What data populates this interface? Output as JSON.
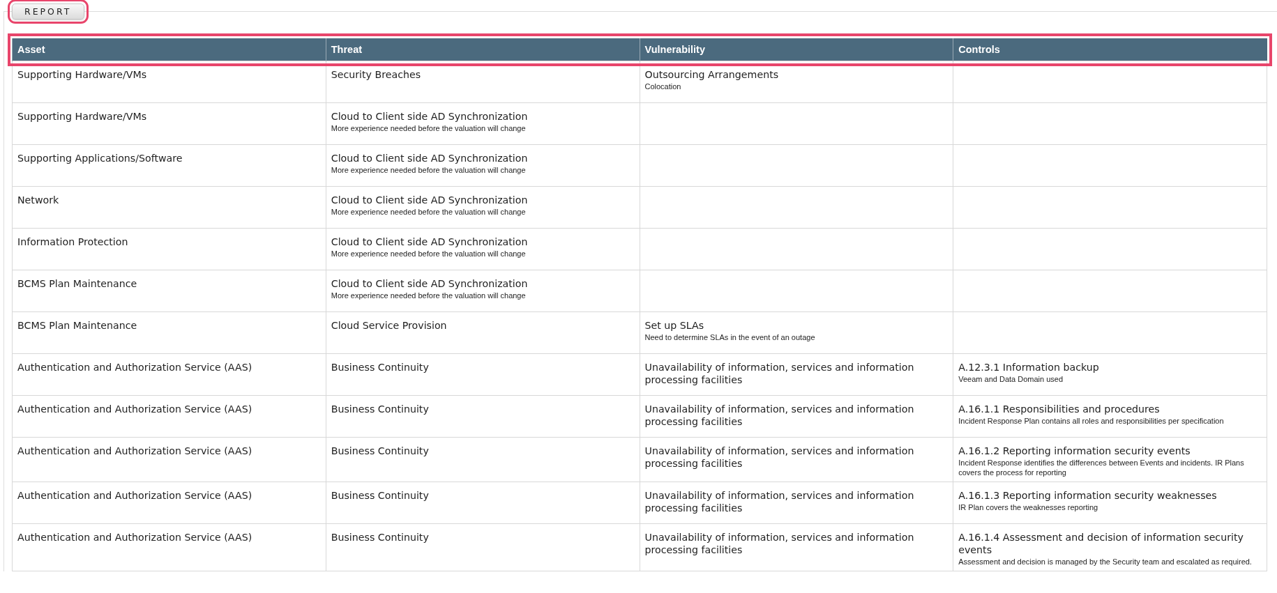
{
  "report_button": {
    "label": "REPORT"
  },
  "table": {
    "columns": [
      "Asset",
      "Threat",
      "Vulnerability",
      "Controls"
    ],
    "rows": [
      {
        "asset": "Supporting Hardware/VMs",
        "threat": {
          "title": "Security Breaches"
        },
        "vulnerability": {
          "title": "Outsourcing Arrangements",
          "note": "Colocation"
        }
      },
      {
        "asset": "Supporting Hardware/VMs",
        "threat": {
          "title": "Cloud to Client side AD Synchronization",
          "note": "More experience needed before the valuation will change"
        }
      },
      {
        "asset": "Supporting Applications/Software",
        "threat": {
          "title": "Cloud to Client side AD Synchronization",
          "note": "More experience needed before the valuation will change"
        }
      },
      {
        "asset": "Network",
        "threat": {
          "title": "Cloud to Client side AD Synchronization",
          "note": "More experience needed before the valuation will change"
        }
      },
      {
        "asset": "Information Protection",
        "threat": {
          "title": "Cloud to Client side AD Synchronization",
          "note": "More experience needed before the valuation will change"
        }
      },
      {
        "asset": "BCMS Plan Maintenance",
        "threat": {
          "title": "Cloud to Client side AD Synchronization",
          "note": "More experience needed before the valuation will change"
        }
      },
      {
        "asset": "BCMS Plan Maintenance",
        "threat": {
          "title": "Cloud Service Provision"
        },
        "vulnerability": {
          "title": "Set up SLAs",
          "note": "Need to determine SLAs in the event of an outage"
        }
      },
      {
        "asset": "Authentication and Authorization Service (AAS)",
        "threat": {
          "title": "Business Continuity"
        },
        "vulnerability": {
          "title": "Unavailability of information, services and information processing facilities"
        },
        "controls": {
          "title": "A.12.3.1 Information backup",
          "note": "Veeam and Data Domain used"
        }
      },
      {
        "asset": "Authentication and Authorization Service (AAS)",
        "threat": {
          "title": "Business Continuity"
        },
        "vulnerability": {
          "title": "Unavailability of information, services and information processing facilities"
        },
        "controls": {
          "title": "A.16.1.1 Responsibilities and procedures",
          "note": "Incident Response Plan contains all roles and responsibilities per specification"
        }
      },
      {
        "asset": "Authentication and Authorization Service (AAS)",
        "threat": {
          "title": "Business Continuity"
        },
        "vulnerability": {
          "title": "Unavailability of information, services and information processing facilities"
        },
        "controls": {
          "title": "A.16.1.2 Reporting information security events",
          "note": "Incident Response identifies the differences between Events and incidents. IR Plans covers the process for reporting"
        }
      },
      {
        "asset": "Authentication and Authorization Service (AAS)",
        "threat": {
          "title": "Business Continuity"
        },
        "vulnerability": {
          "title": "Unavailability of information, services and information processing facilities"
        },
        "controls": {
          "title": "A.16.1.3 Reporting information security weaknesses",
          "note": "IR Plan covers the weaknesses reporting"
        }
      },
      {
        "asset": "Authentication and Authorization Service (AAS)",
        "threat": {
          "title": "Business Continuity"
        },
        "vulnerability": {
          "title": "Unavailability of information, services and information processing facilities"
        },
        "controls": {
          "title": "A.16.1.4 Assessment and decision of information security events",
          "note": "Assessment and decision is managed by the Security team and escalated as required."
        }
      }
    ]
  }
}
